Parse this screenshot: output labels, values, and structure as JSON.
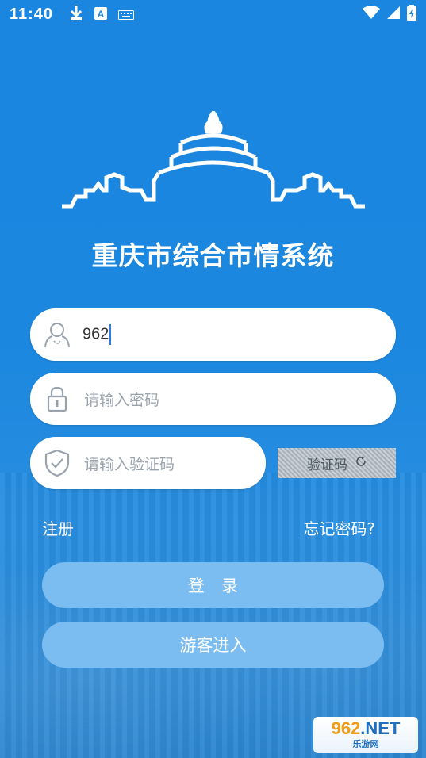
{
  "status_bar": {
    "time": "11:40",
    "icons_left": [
      "download-icon",
      "keyboard-a-icon",
      "keyboard-icon"
    ],
    "icons_right": [
      "wifi-icon",
      "signal-icon",
      "battery-icon"
    ]
  },
  "app": {
    "title": "重庆市综合市情系统",
    "logo": "temple-logo-icon"
  },
  "login": {
    "username_value": "962",
    "password_placeholder": "请输入密码",
    "captcha_placeholder": "请输入验证码",
    "captcha_image_text": "验证码"
  },
  "links": {
    "register": "注册",
    "forgot_password": "忘记密码?"
  },
  "buttons": {
    "login": "登　录",
    "guest": "游客进入"
  },
  "colors": {
    "background": "#1a86e0",
    "button": "#7bbcf1",
    "field": "#ffffff"
  },
  "watermark": {
    "line1_a": "962",
    "line1_b": ".NET",
    "line2": "乐游网"
  }
}
